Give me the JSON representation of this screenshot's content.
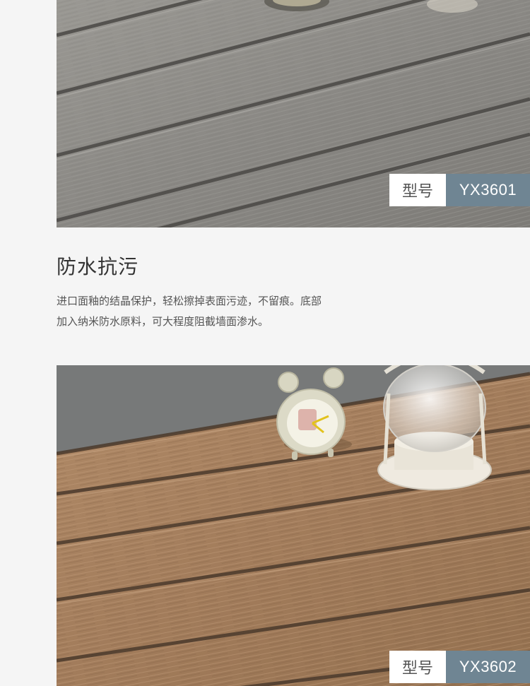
{
  "products": [
    {
      "tag_label": "型号",
      "model": "YX3601"
    },
    {
      "tag_label": "型号",
      "model": "YX3602"
    }
  ],
  "feature": {
    "title": "防水抗污",
    "lines": [
      "进口面釉的结晶保护，轻松擦掉表面污迹，不留痕。底部",
      "加入纳米防水原料，可大程度阻截墙面渗水。"
    ]
  },
  "colors": {
    "page_bg": "#f5f5f5",
    "tag_value_bg": "#6f8593",
    "tag_label_bg": "#ffffff",
    "grey_wood": "#8b8a86",
    "brown_wood": "#a37d5c"
  }
}
